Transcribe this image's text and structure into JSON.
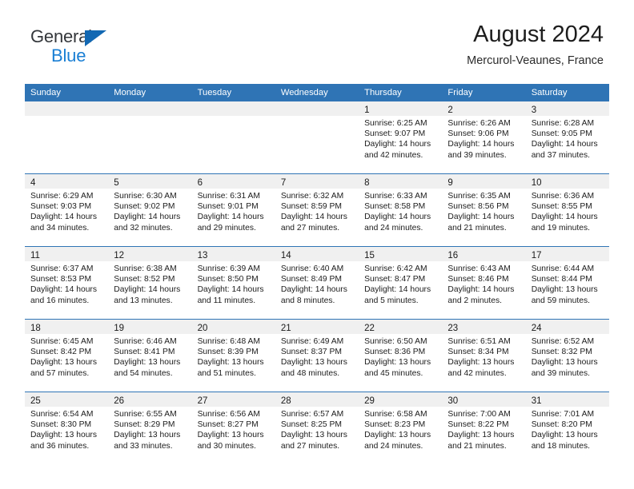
{
  "logo": {
    "word_top": "General",
    "word_bottom": "Blue",
    "triangle_color": "#1268b3",
    "blue_color": "#1a7fd4"
  },
  "header": {
    "title": "August 2024",
    "subtitle": "Mercurol-Veaunes, France"
  },
  "theme": {
    "header_bar": "#2f74b5",
    "daynum_band": "#f0f0f0",
    "text": "#1c1c1c"
  },
  "weekdays": [
    "Sunday",
    "Monday",
    "Tuesday",
    "Wednesday",
    "Thursday",
    "Friday",
    "Saturday"
  ],
  "labels": {
    "sunrise_prefix": "Sunrise:",
    "sunset_prefix": "Sunset:",
    "daylight_prefix": "Daylight:"
  },
  "weeks": [
    [
      {
        "day": "",
        "empty": true
      },
      {
        "day": "",
        "empty": true
      },
      {
        "day": "",
        "empty": true
      },
      {
        "day": "",
        "empty": true
      },
      {
        "day": "1",
        "sunrise": "Sunrise: 6:25 AM",
        "sunset": "Sunset: 9:07 PM",
        "daylight1": "Daylight: 14 hours",
        "daylight2": "and 42 minutes."
      },
      {
        "day": "2",
        "sunrise": "Sunrise: 6:26 AM",
        "sunset": "Sunset: 9:06 PM",
        "daylight1": "Daylight: 14 hours",
        "daylight2": "and 39 minutes."
      },
      {
        "day": "3",
        "sunrise": "Sunrise: 6:28 AM",
        "sunset": "Sunset: 9:05 PM",
        "daylight1": "Daylight: 14 hours",
        "daylight2": "and 37 minutes."
      }
    ],
    [
      {
        "day": "4",
        "sunrise": "Sunrise: 6:29 AM",
        "sunset": "Sunset: 9:03 PM",
        "daylight1": "Daylight: 14 hours",
        "daylight2": "and 34 minutes."
      },
      {
        "day": "5",
        "sunrise": "Sunrise: 6:30 AM",
        "sunset": "Sunset: 9:02 PM",
        "daylight1": "Daylight: 14 hours",
        "daylight2": "and 32 minutes."
      },
      {
        "day": "6",
        "sunrise": "Sunrise: 6:31 AM",
        "sunset": "Sunset: 9:01 PM",
        "daylight1": "Daylight: 14 hours",
        "daylight2": "and 29 minutes."
      },
      {
        "day": "7",
        "sunrise": "Sunrise: 6:32 AM",
        "sunset": "Sunset: 8:59 PM",
        "daylight1": "Daylight: 14 hours",
        "daylight2": "and 27 minutes."
      },
      {
        "day": "8",
        "sunrise": "Sunrise: 6:33 AM",
        "sunset": "Sunset: 8:58 PM",
        "daylight1": "Daylight: 14 hours",
        "daylight2": "and 24 minutes."
      },
      {
        "day": "9",
        "sunrise": "Sunrise: 6:35 AM",
        "sunset": "Sunset: 8:56 PM",
        "daylight1": "Daylight: 14 hours",
        "daylight2": "and 21 minutes."
      },
      {
        "day": "10",
        "sunrise": "Sunrise: 6:36 AM",
        "sunset": "Sunset: 8:55 PM",
        "daylight1": "Daylight: 14 hours",
        "daylight2": "and 19 minutes."
      }
    ],
    [
      {
        "day": "11",
        "sunrise": "Sunrise: 6:37 AM",
        "sunset": "Sunset: 8:53 PM",
        "daylight1": "Daylight: 14 hours",
        "daylight2": "and 16 minutes."
      },
      {
        "day": "12",
        "sunrise": "Sunrise: 6:38 AM",
        "sunset": "Sunset: 8:52 PM",
        "daylight1": "Daylight: 14 hours",
        "daylight2": "and 13 minutes."
      },
      {
        "day": "13",
        "sunrise": "Sunrise: 6:39 AM",
        "sunset": "Sunset: 8:50 PM",
        "daylight1": "Daylight: 14 hours",
        "daylight2": "and 11 minutes."
      },
      {
        "day": "14",
        "sunrise": "Sunrise: 6:40 AM",
        "sunset": "Sunset: 8:49 PM",
        "daylight1": "Daylight: 14 hours",
        "daylight2": "and 8 minutes."
      },
      {
        "day": "15",
        "sunrise": "Sunrise: 6:42 AM",
        "sunset": "Sunset: 8:47 PM",
        "daylight1": "Daylight: 14 hours",
        "daylight2": "and 5 minutes."
      },
      {
        "day": "16",
        "sunrise": "Sunrise: 6:43 AM",
        "sunset": "Sunset: 8:46 PM",
        "daylight1": "Daylight: 14 hours",
        "daylight2": "and 2 minutes."
      },
      {
        "day": "17",
        "sunrise": "Sunrise: 6:44 AM",
        "sunset": "Sunset: 8:44 PM",
        "daylight1": "Daylight: 13 hours",
        "daylight2": "and 59 minutes."
      }
    ],
    [
      {
        "day": "18",
        "sunrise": "Sunrise: 6:45 AM",
        "sunset": "Sunset: 8:42 PM",
        "daylight1": "Daylight: 13 hours",
        "daylight2": "and 57 minutes."
      },
      {
        "day": "19",
        "sunrise": "Sunrise: 6:46 AM",
        "sunset": "Sunset: 8:41 PM",
        "daylight1": "Daylight: 13 hours",
        "daylight2": "and 54 minutes."
      },
      {
        "day": "20",
        "sunrise": "Sunrise: 6:48 AM",
        "sunset": "Sunset: 8:39 PM",
        "daylight1": "Daylight: 13 hours",
        "daylight2": "and 51 minutes."
      },
      {
        "day": "21",
        "sunrise": "Sunrise: 6:49 AM",
        "sunset": "Sunset: 8:37 PM",
        "daylight1": "Daylight: 13 hours",
        "daylight2": "and 48 minutes."
      },
      {
        "day": "22",
        "sunrise": "Sunrise: 6:50 AM",
        "sunset": "Sunset: 8:36 PM",
        "daylight1": "Daylight: 13 hours",
        "daylight2": "and 45 minutes."
      },
      {
        "day": "23",
        "sunrise": "Sunrise: 6:51 AM",
        "sunset": "Sunset: 8:34 PM",
        "daylight1": "Daylight: 13 hours",
        "daylight2": "and 42 minutes."
      },
      {
        "day": "24",
        "sunrise": "Sunrise: 6:52 AM",
        "sunset": "Sunset: 8:32 PM",
        "daylight1": "Daylight: 13 hours",
        "daylight2": "and 39 minutes."
      }
    ],
    [
      {
        "day": "25",
        "sunrise": "Sunrise: 6:54 AM",
        "sunset": "Sunset: 8:30 PM",
        "daylight1": "Daylight: 13 hours",
        "daylight2": "and 36 minutes."
      },
      {
        "day": "26",
        "sunrise": "Sunrise: 6:55 AM",
        "sunset": "Sunset: 8:29 PM",
        "daylight1": "Daylight: 13 hours",
        "daylight2": "and 33 minutes."
      },
      {
        "day": "27",
        "sunrise": "Sunrise: 6:56 AM",
        "sunset": "Sunset: 8:27 PM",
        "daylight1": "Daylight: 13 hours",
        "daylight2": "and 30 minutes."
      },
      {
        "day": "28",
        "sunrise": "Sunrise: 6:57 AM",
        "sunset": "Sunset: 8:25 PM",
        "daylight1": "Daylight: 13 hours",
        "daylight2": "and 27 minutes."
      },
      {
        "day": "29",
        "sunrise": "Sunrise: 6:58 AM",
        "sunset": "Sunset: 8:23 PM",
        "daylight1": "Daylight: 13 hours",
        "daylight2": "and 24 minutes."
      },
      {
        "day": "30",
        "sunrise": "Sunrise: 7:00 AM",
        "sunset": "Sunset: 8:22 PM",
        "daylight1": "Daylight: 13 hours",
        "daylight2": "and 21 minutes."
      },
      {
        "day": "31",
        "sunrise": "Sunrise: 7:01 AM",
        "sunset": "Sunset: 8:20 PM",
        "daylight1": "Daylight: 13 hours",
        "daylight2": "and 18 minutes."
      }
    ]
  ]
}
